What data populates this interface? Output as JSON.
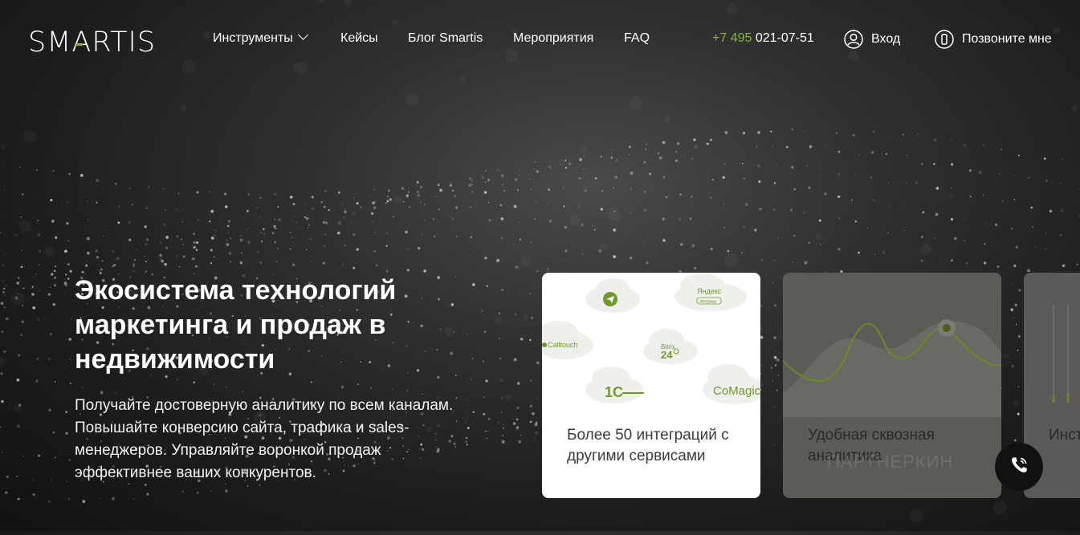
{
  "header": {
    "logo_text": "SMARTIS",
    "nav": [
      {
        "label": "Инструменты",
        "has_dropdown": true
      },
      {
        "label": "Кейсы"
      },
      {
        "label": "Блог Smartis"
      },
      {
        "label": "Мероприятия"
      },
      {
        "label": "FAQ"
      }
    ],
    "phone_code": "+7 495",
    "phone_number": "021-07-51",
    "login_label": "Вход",
    "callback_label": "Позвоните мне"
  },
  "hero": {
    "title": "Экосистема технологий маркетинга и продаж в недвижимости",
    "subtitle": "Получайте достоверную аналитику по всем каналам. Повышайте конверсию сайта, трафика и sales-менеджеров. Управляйте воронкой продаж эффективнее ваших конкурентов."
  },
  "cards": [
    {
      "text": "Более 50 интеграций с другими сервисами",
      "logos": [
        "Яндекс",
        "Метрика",
        "Calltouch",
        "Bitrix",
        "24",
        "1С",
        "CoMagic"
      ]
    },
    {
      "text": "Удобная сквозная аналитика"
    },
    {
      "text": "Инст пові"
    }
  ],
  "watermark": "ПАРТНЕРКИН",
  "colors": {
    "accent": "#8ab43d",
    "background": "#1c1c1c"
  },
  "icons": {
    "login": "user-circle-icon",
    "callback": "phone-outline-icon",
    "call_button": "phone-call-icon"
  }
}
